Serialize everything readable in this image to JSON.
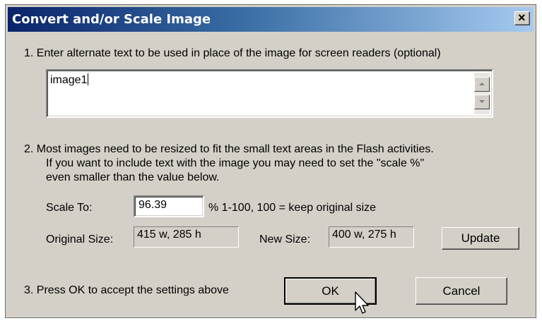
{
  "window": {
    "title": "Convert and/or Scale Image",
    "close_symbol": "✕"
  },
  "step1": {
    "text": "1.  Enter alternate text to be used in place of the image for screen readers  (optional)",
    "alt_text_value": "image1"
  },
  "step2": {
    "line1": "2.  Most images need to be resized to fit the small text areas in the Flash activities.",
    "line2": "If you want to include text with the image you may need to set the \"scale %\"",
    "line3": "even smaller than the value below.",
    "scale_label": "Scale To:",
    "scale_value": "96.39",
    "scale_hint": "%  1-100,  100 = keep original size",
    "original_label": "Original Size:",
    "original_value": "415 w, 285 h",
    "new_label": "New Size:",
    "new_value": "400 w, 275 h",
    "update_label": "Update"
  },
  "step3": {
    "text": "3.  Press OK to accept the settings above",
    "ok_label": "OK",
    "cancel_label": "Cancel"
  }
}
